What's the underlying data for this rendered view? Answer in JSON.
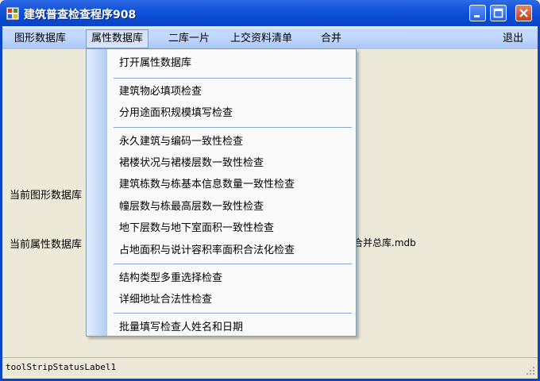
{
  "window": {
    "title": "建筑普查检查程序908"
  },
  "menubar": {
    "items": [
      "图形数据库",
      "属性数据库",
      "二库一片",
      "上交资料清单",
      "合并"
    ],
    "exit_label": "退出"
  },
  "main": {
    "graphic_db_label": "当前图形数据库",
    "attribute_db_label": "当前属性数据库",
    "attribute_db_path_suffix": "合并总库.mdb"
  },
  "dropdown": {
    "group1": [
      "打开属性数据库"
    ],
    "group2": [
      "建筑物必填项检查",
      "分用途面积规模填写检查"
    ],
    "group3": [
      "永久建筑与编码一致性检查",
      "裙楼状况与裙楼层数一致性检查",
      "建筑栋数与栋基本信息数量一致性检查",
      "幢层数与栋最高层数一致性检查",
      "地下层数与地下室面积一致性检查",
      "占地面积与说计容积率面积合法化检查"
    ],
    "group4": [
      "结构类型多重选择检查",
      "详细地址合法性检查"
    ],
    "group5": [
      "批量填写检查人姓名和日期"
    ]
  },
  "statusbar": {
    "label": "toolStripStatusLabel1"
  }
}
